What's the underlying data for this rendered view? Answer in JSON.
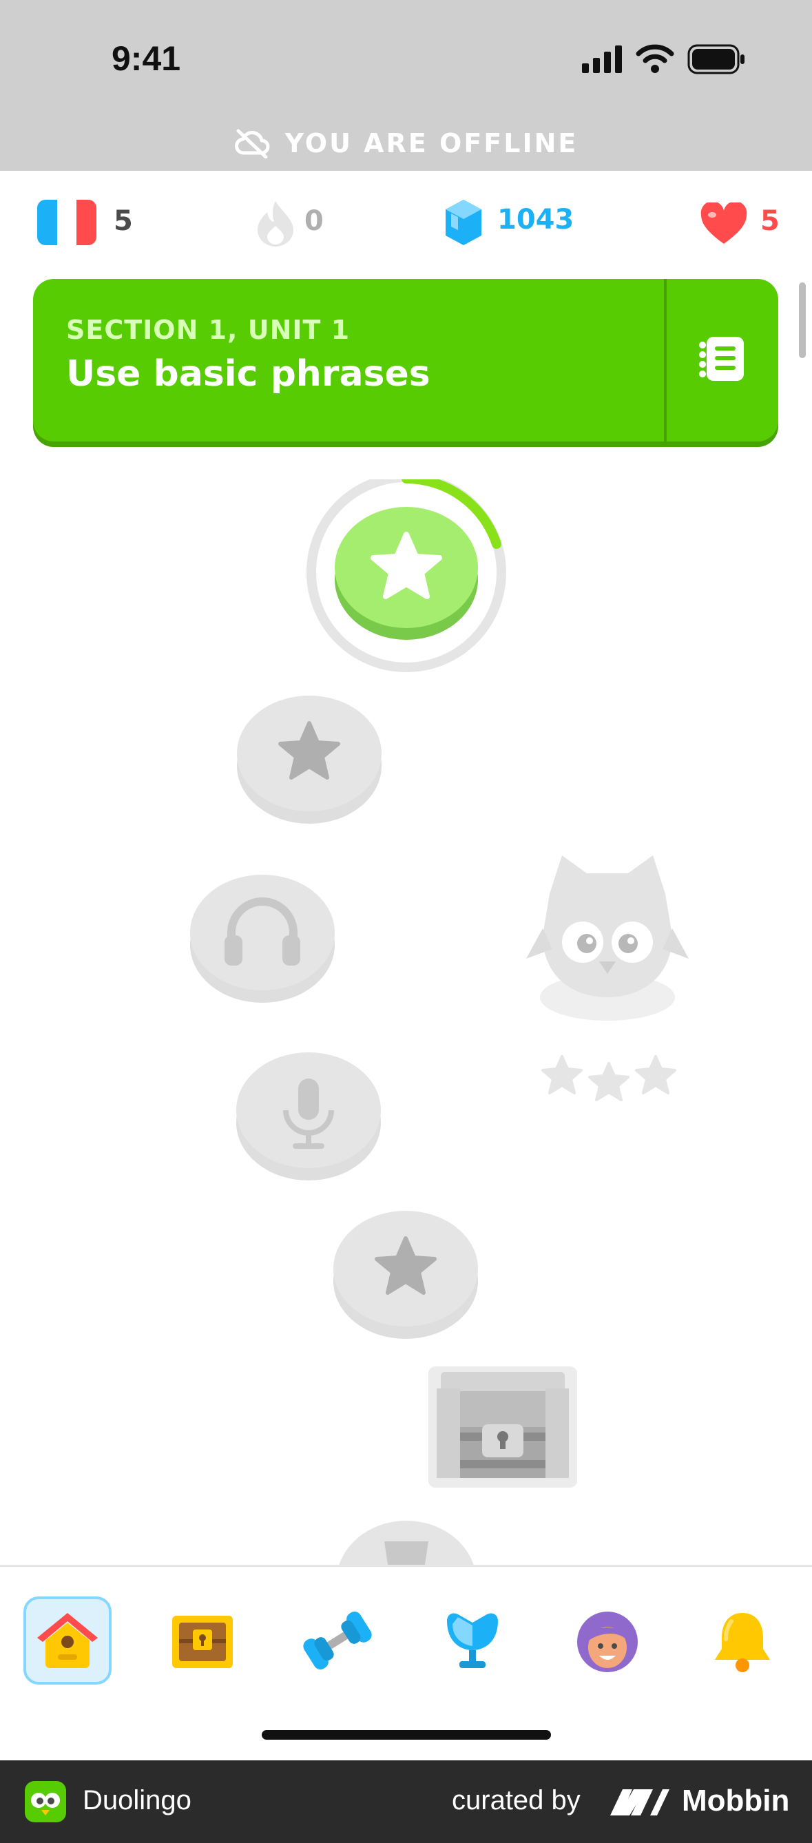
{
  "status_bar": {
    "time": "9:41"
  },
  "offline_banner": {
    "text": "YOU ARE OFFLINE"
  },
  "stats": {
    "course_count": "5",
    "streak": "0",
    "gems": "1043",
    "hearts": "5"
  },
  "section": {
    "subtitle": "SECTION 1, UNIT 1",
    "title": "Use basic phrases"
  },
  "path": {
    "nodes": [
      "star-active",
      "star-locked",
      "headphones-locked",
      "microphone-locked",
      "star-locked",
      "chest-locked",
      "trophy-locked"
    ],
    "active_progress": 0.2
  },
  "nav": {
    "items": [
      "home",
      "shop-chest",
      "practice-dumbbell",
      "leagues",
      "profile",
      "notifications"
    ],
    "active": "home"
  },
  "footer": {
    "app_name": "Duolingo",
    "curated_by": "curated by",
    "brand": "Mobbin"
  },
  "colors": {
    "green": "#58cc02",
    "blue": "#1cb0f6",
    "red": "#ff4b4b",
    "gray": "#e5e5e5"
  }
}
